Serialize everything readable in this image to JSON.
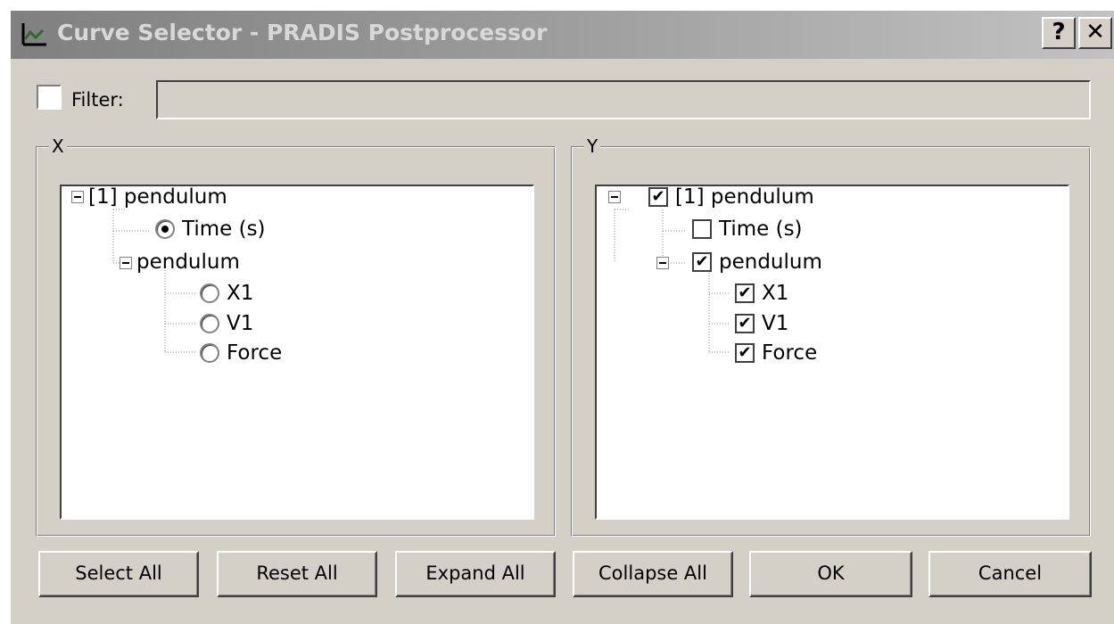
{
  "window": {
    "title": "Curve Selector - PRADIS Postprocessor",
    "help_label": "?",
    "close_label": "✕"
  },
  "filter": {
    "label": "Filter:",
    "checked": false,
    "value": ""
  },
  "x_panel": {
    "title": "X",
    "tree": [
      {
        "label": "[1] pendulum",
        "kind": "node"
      },
      {
        "label": "Time (s)",
        "kind": "radio",
        "selected": true
      },
      {
        "label": "pendulum",
        "kind": "node"
      },
      {
        "label": "X1",
        "kind": "radio",
        "selected": false
      },
      {
        "label": "V1",
        "kind": "radio",
        "selected": false
      },
      {
        "label": "Force",
        "kind": "radio",
        "selected": false
      }
    ]
  },
  "y_panel": {
    "title": "Y",
    "tree": [
      {
        "label": "[1] pendulum",
        "kind": "check",
        "checked": true
      },
      {
        "label": "Time (s)",
        "kind": "check",
        "checked": false
      },
      {
        "label": "pendulum",
        "kind": "check",
        "checked": true
      },
      {
        "label": "X1",
        "kind": "check",
        "checked": true
      },
      {
        "label": "V1",
        "kind": "check",
        "checked": true
      },
      {
        "label": "Force",
        "kind": "check",
        "checked": true
      }
    ]
  },
  "buttons": {
    "select_all": "Select All",
    "reset_all": "Reset All",
    "expand_all": "Expand All",
    "collapse_all": "Collapse All",
    "ok": "OK",
    "cancel": "Cancel"
  },
  "check_glyph": "✔"
}
